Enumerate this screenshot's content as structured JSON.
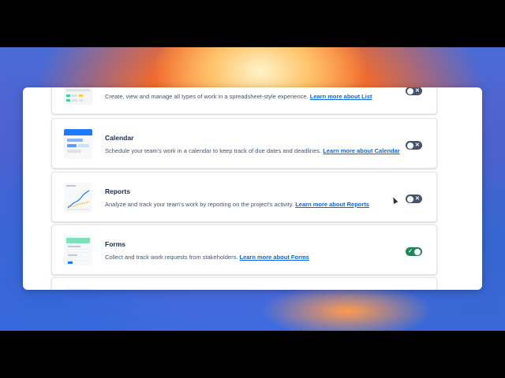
{
  "features": [
    {
      "id": "list",
      "title": "",
      "description": "Create, view and manage all types of work in a spreadsheet-style experience.",
      "link": "Learn more about List",
      "enabled": false,
      "toggle_glyph": "✕"
    },
    {
      "id": "calendar",
      "title": "Calendar",
      "description": "Schedule your team's work in a calendar to keep track of due dates and deadlines.",
      "link": "Learn more about Calendar",
      "enabled": false,
      "toggle_glyph": "✕"
    },
    {
      "id": "reports",
      "title": "Reports",
      "description": "Analyze and track your team's work by reporting on the project's activity.",
      "link": "Learn more about Reports",
      "enabled": false,
      "toggle_glyph": "✕"
    },
    {
      "id": "forms",
      "title": "Forms",
      "description": "Collect and track work requests from stakeholders.",
      "link": "Learn more about Forms",
      "enabled": true,
      "toggle_glyph": "✓"
    }
  ],
  "colors": {
    "toggle_off": "#44546f",
    "toggle_on": "#1f845a",
    "link": "#0c66e4"
  }
}
